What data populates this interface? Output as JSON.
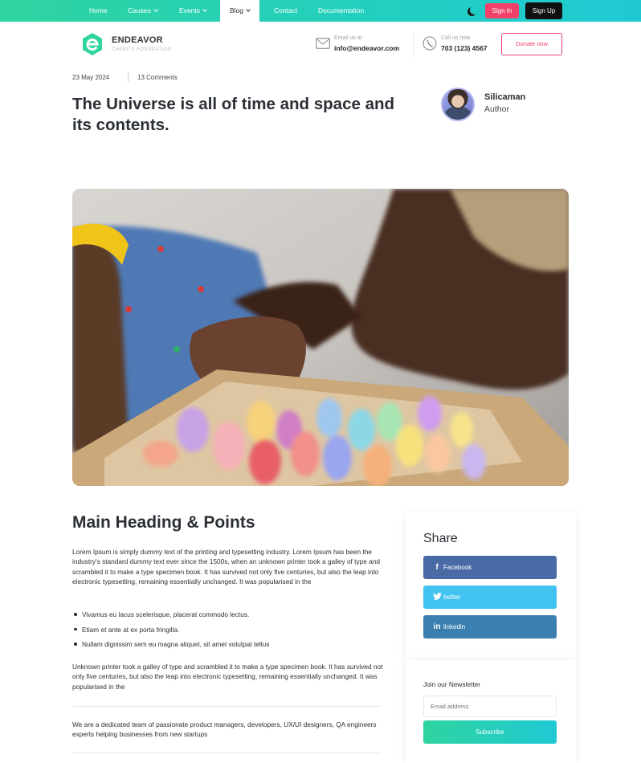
{
  "nav": {
    "items": [
      {
        "label": "Home",
        "caret": false
      },
      {
        "label": "Causes",
        "caret": true
      },
      {
        "label": "Events",
        "caret": true
      },
      {
        "label": "Blog",
        "caret": true,
        "active": true
      },
      {
        "label": "Contact",
        "caret": false
      },
      {
        "label": "Documentation",
        "caret": false
      }
    ],
    "theme_icon": "moon-icon",
    "signin_label": "Sign In",
    "signup_label": "Sign Up",
    "gradient": [
      "#2fd4a0",
      "#1fc9d4"
    ]
  },
  "header": {
    "brand_name": "ENDEAVOR",
    "brand_tagline": "CHARITY FOUNDATION",
    "email_label": "Email us at",
    "email_value": "info@endeavor.com",
    "phone_label": "Call us now",
    "phone_value": "703 (123) 4567",
    "donate_label": "Donate now"
  },
  "post": {
    "date": "23 May 2024",
    "comments": "13 Comments",
    "title": "The Universe is all of time and space and its contents.",
    "author_name": "Silicaman",
    "author_role": "Author"
  },
  "article": {
    "heading": "Main Heading & Points",
    "intro": "Lorem Ipsum is simply dummy text of the printing and typesetting industry. Lorem Ipsum has been the industry's standard dummy text ever since the 1500s, when an unknown printer took a galley of type and scrambled it to make a type specimen book. It has survived not only five centuries, but also the leap into electronic typesetting, remaining essentially unchanged. It was popularised in the",
    "points": [
      "Vivamus eu lacus scelerisque, placerat commodo lectus.",
      "Etiam et ante at ex porta fringilla.",
      "Nullam dignissim sem eu magna aliquet, sit amet volutpat tellus"
    ],
    "body": "Unknown printer took a galley of type and scrambled it to make a type specimen book. It has survived not only five centuries, but also the leap into electronic typesetting, remaining essentially unchanged. It was popularised in the",
    "about": "We are a dedicated team of passionate product managers, developers, UX/UI designers, QA engineers experts helping businesses from new startups"
  },
  "share": {
    "title": "Share",
    "buttons": [
      {
        "label": "Facebook",
        "icon": "facebook-icon",
        "color": "#4a6aa5"
      },
      {
        "label": "twitter",
        "icon": "twitter-icon",
        "color": "#41c2f0"
      },
      {
        "label": "linkedin",
        "icon": "linkedin-icon",
        "color": "#3a7fb0"
      }
    ]
  },
  "newsletter": {
    "title": "Join our Newsletter",
    "placeholder": "Email address",
    "button_label": "Subscribe"
  },
  "colors": {
    "brand_green": "#2fd4a0",
    "accent_pink": "#f2426a",
    "text_dark": "#2b2f36"
  }
}
